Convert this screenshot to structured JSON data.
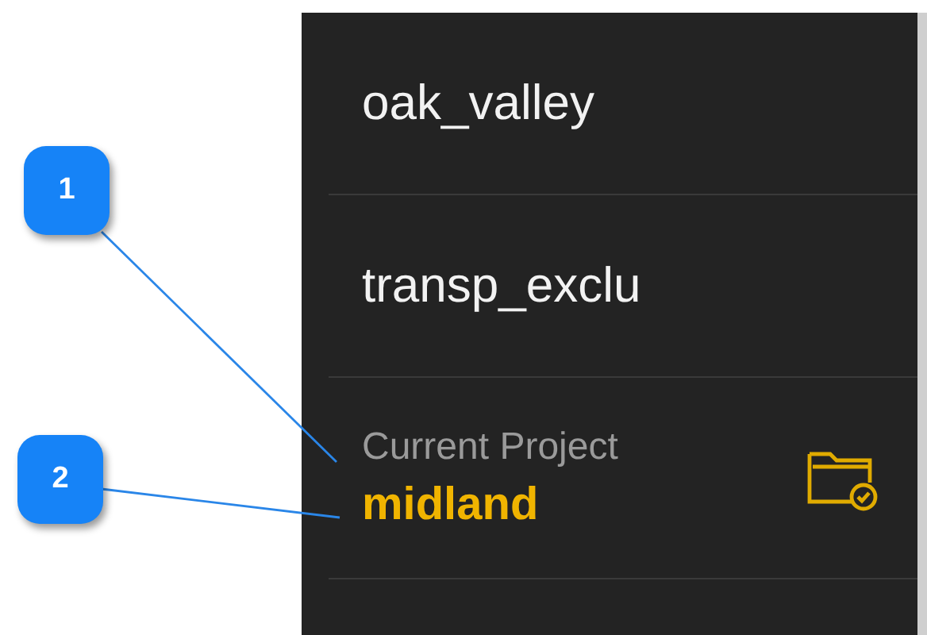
{
  "project_list": [
    {
      "kind": "project",
      "name": "oak_valley"
    },
    {
      "kind": "project",
      "name": "transp_exclu"
    },
    {
      "kind": "current",
      "label": "Current Project",
      "name": "midland"
    }
  ],
  "callouts": [
    {
      "number": "1"
    },
    {
      "number": "2"
    }
  ]
}
